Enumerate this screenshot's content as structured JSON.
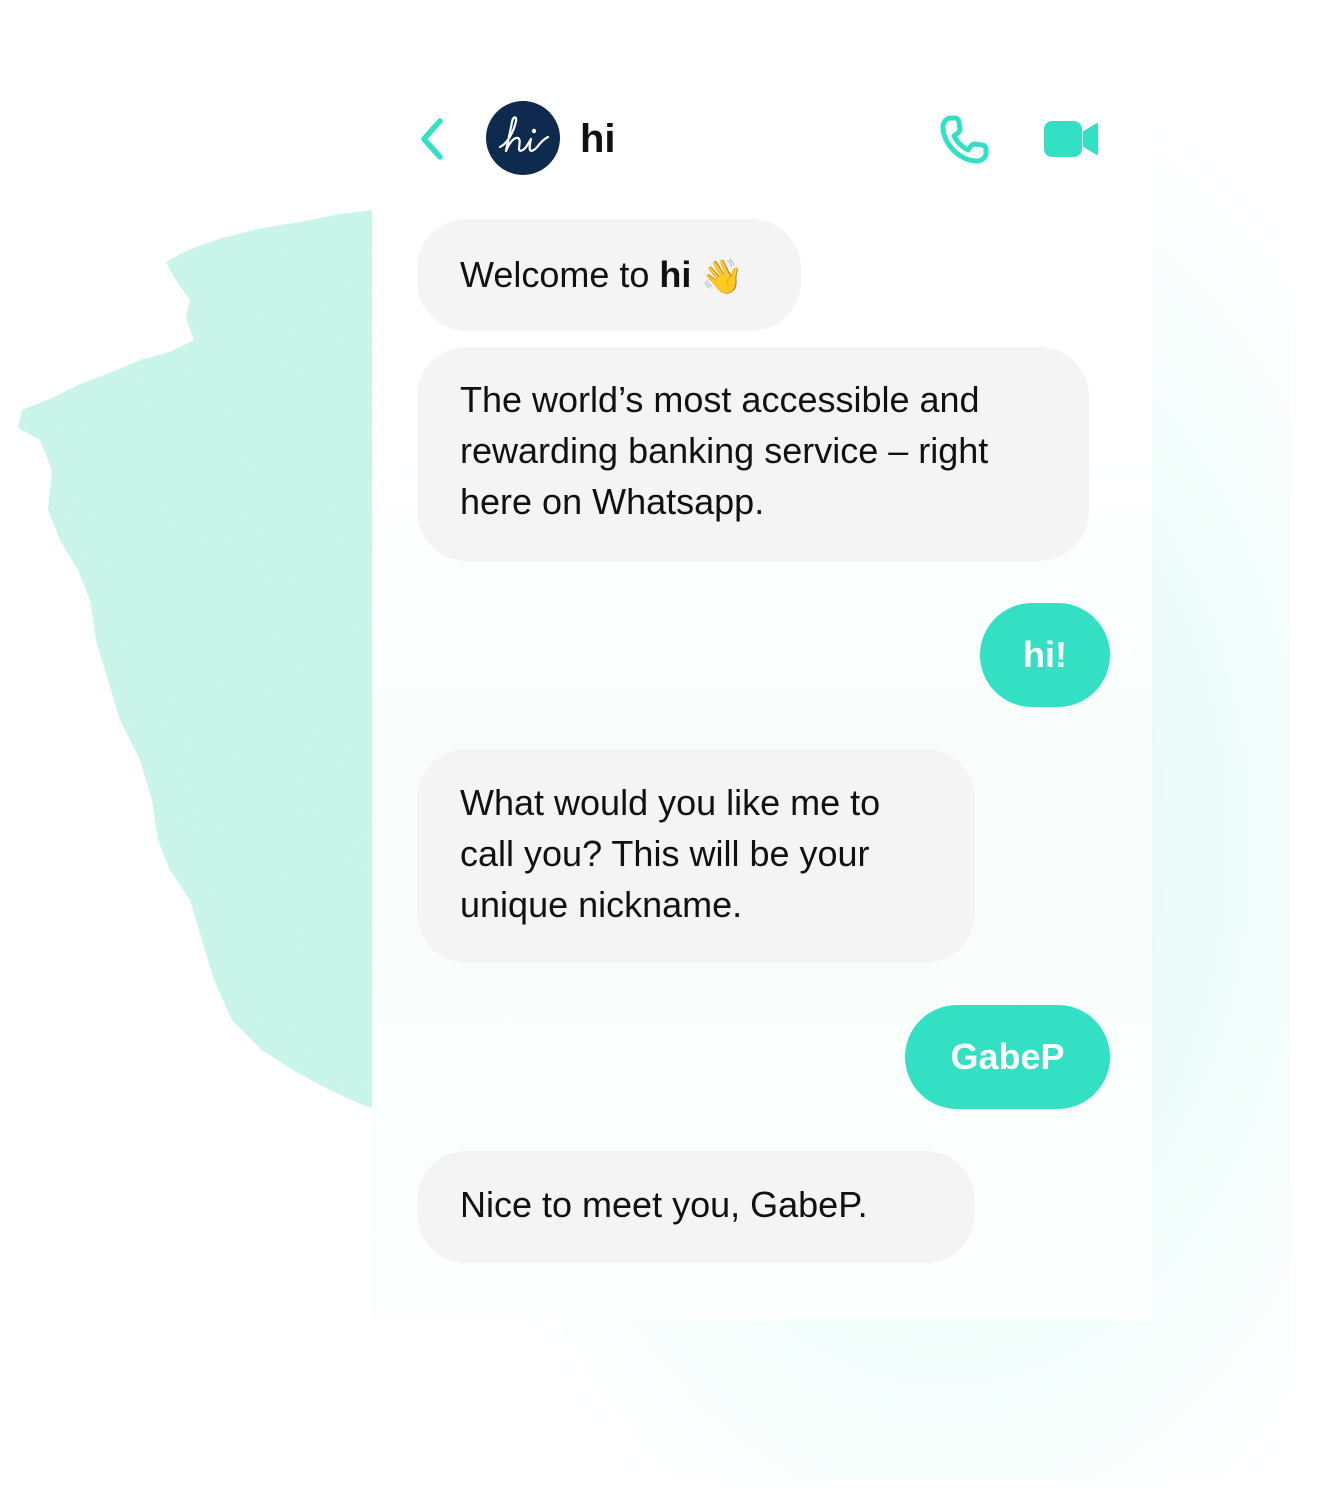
{
  "colors": {
    "accent": "#33E0C3",
    "avatar_bg": "#0E2A4F",
    "incoming_bubble": "#F4F4F4",
    "text": "#111111"
  },
  "header": {
    "back_icon": "chevron-left-icon",
    "avatar_logo_text": "hi",
    "contact_name": "hi",
    "call_icon": "phone-icon",
    "video_icon": "video-camera-icon"
  },
  "messages": [
    {
      "direction": "incoming",
      "prefix": "Welcome to ",
      "bold": "hi",
      "emoji": "👋"
    },
    {
      "direction": "incoming",
      "lines": [
        "The world’s most accessible and",
        "rewarding banking service – right",
        "here on Whatsapp."
      ]
    },
    {
      "direction": "outgoing",
      "text": "hi!"
    },
    {
      "direction": "incoming",
      "lines": [
        "What would you like me to",
        "call you? This will be your",
        "unique nickname."
      ]
    },
    {
      "direction": "outgoing",
      "text": "GabeP"
    },
    {
      "direction": "incoming",
      "text": "Nice to meet you, GabeP."
    }
  ]
}
